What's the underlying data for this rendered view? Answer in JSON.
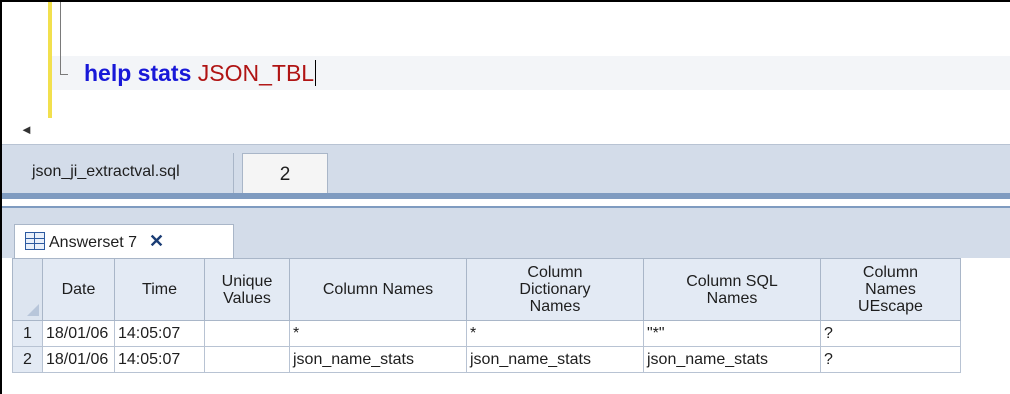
{
  "editor": {
    "keyword": "help stats",
    "identifier": "JSON_TBL",
    "scroll_left_glyph": "◄"
  },
  "doc_tabs": {
    "file_tab": "json_ji_extractval.sql",
    "number_tab": "2"
  },
  "result_tab": {
    "label": "Answerset 7",
    "close_glyph": "✕"
  },
  "grid": {
    "headers": [
      "Date",
      "Time",
      "Unique\nValues",
      "Column Names",
      "Column\nDictionary\nNames",
      "Column SQL\nNames",
      "Column\nNames\nUEscape"
    ],
    "rows": [
      {
        "num": "1",
        "cells": [
          "18/01/06",
          "14:05:07",
          "",
          "*",
          "*",
          "\"*\"",
          "?"
        ]
      },
      {
        "num": "2",
        "cells": [
          "18/01/06",
          "14:05:07",
          "",
          "json_name_stats",
          "json_name_stats",
          "json_name_stats",
          "?"
        ]
      }
    ]
  }
}
